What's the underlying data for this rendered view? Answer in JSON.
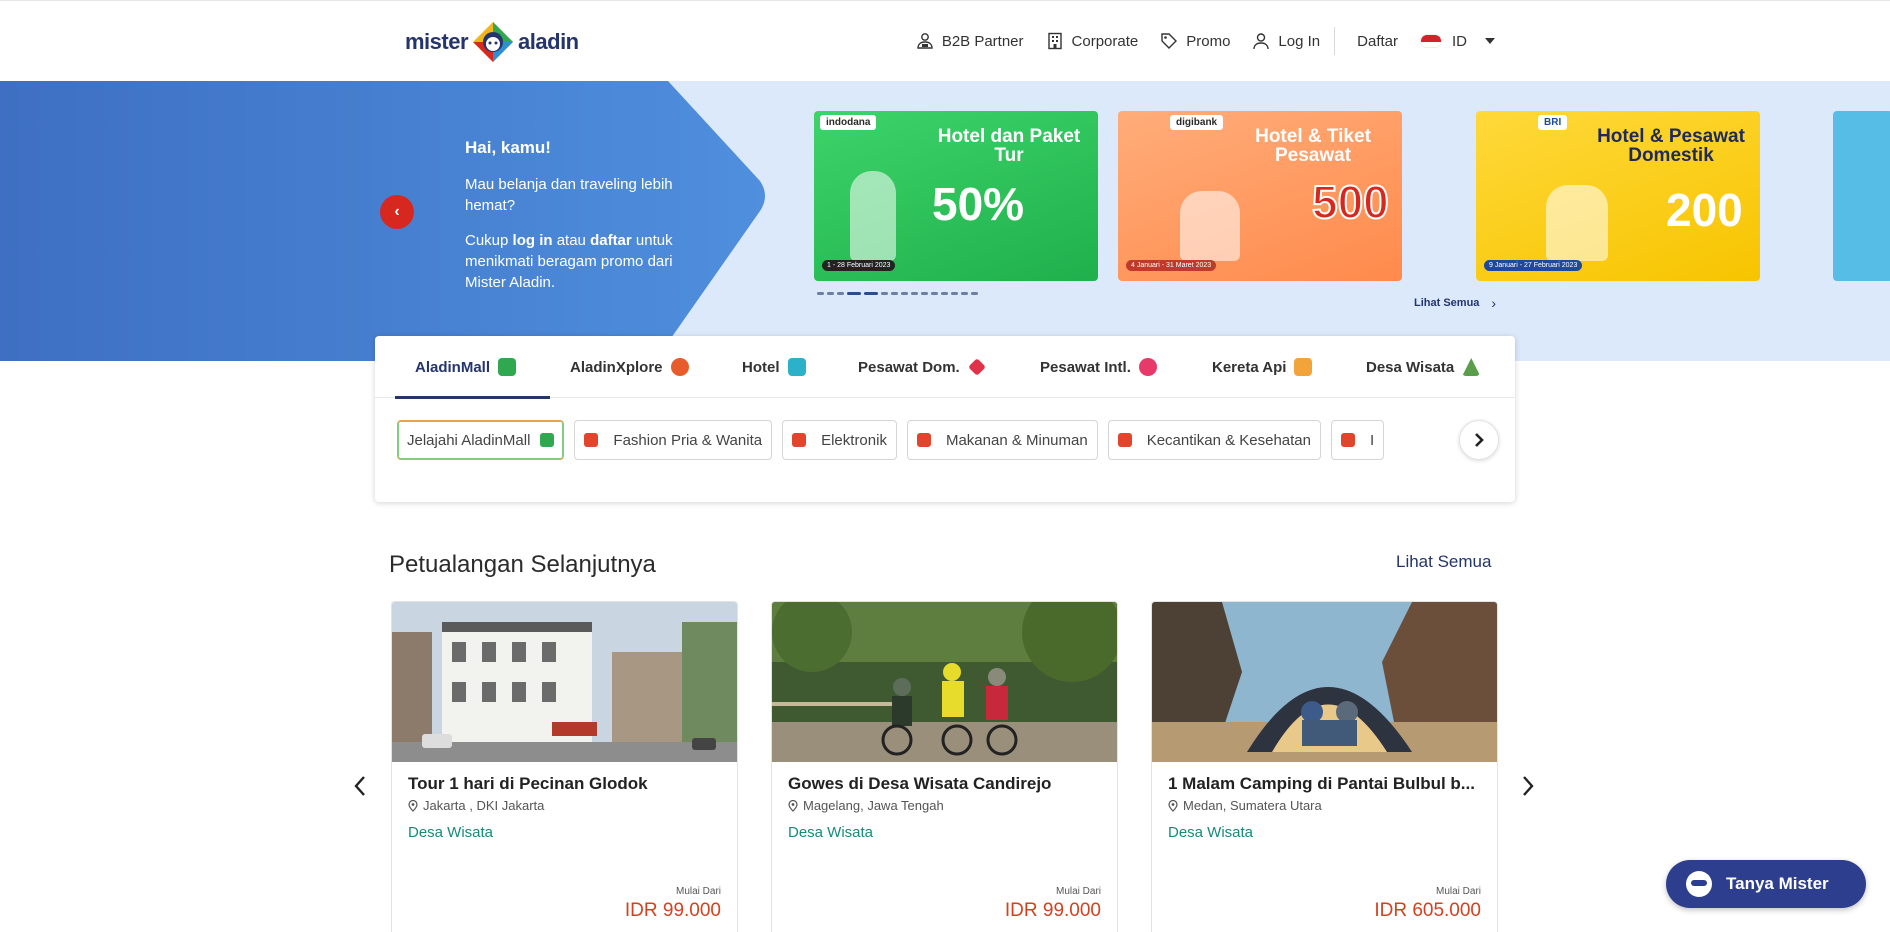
{
  "header": {
    "logo_left": "mister",
    "logo_right": "aladin",
    "nav": [
      {
        "label": "B2B Partner",
        "icon": "b2b-partner-icon"
      },
      {
        "label": "Corporate",
        "icon": "building-icon"
      },
      {
        "label": "Promo",
        "icon": "tag-icon"
      },
      {
        "label": "Log In",
        "icon": "user-icon"
      }
    ],
    "register": "Daftar",
    "lang": "ID"
  },
  "hero": {
    "greeting": "Hai, kamu!",
    "line1": "Mau belanja dan traveling lebih hemat?",
    "line2_a": "Cukup ",
    "line2_login": "log in",
    "line2_b": " atau ",
    "line2_register": "daftar",
    "line2_c": " untuk menikmati beragam promo dari Mister Aladin.",
    "see_all": "Lihat Semua",
    "banners": [
      {
        "brand": "indodana",
        "title": "Hotel dan Paket Tur",
        "big": "50%",
        "dates": "1 - 28 Februari 2023",
        "color": "#2cc35a"
      },
      {
        "brand": "digibank",
        "title": "Hotel & Tiket Pesawat",
        "big": "500",
        "dates": "4 Januari - 31 Maret 2023",
        "color": "#ff9a62"
      },
      {
        "brand": "BRI",
        "title": "Hotel & Pesawat Domestik",
        "big": "200",
        "dates": "9 Januari - 27 Februari 2023",
        "color": "#f9cc12"
      }
    ]
  },
  "tabs": [
    {
      "label": "AladinMall",
      "color": "#2fa84f",
      "active": true
    },
    {
      "label": "AladinXplore",
      "color": "#e85c2b"
    },
    {
      "label": "Hotel",
      "color": "#2bb2c9"
    },
    {
      "label": "Pesawat Dom.",
      "color": "#e0334a"
    },
    {
      "label": "Pesawat Intl.",
      "color": "#e8396b"
    },
    {
      "label": "Kereta Api",
      "color": "#f2a33a"
    },
    {
      "label": "Desa Wisata",
      "color": "#5a9e4b"
    }
  ],
  "chips": [
    {
      "label": "Jelajahi AladinMall",
      "color": "#2fa84f"
    },
    {
      "label": "Fashion Pria & Wanita",
      "color": "#e2452c"
    },
    {
      "label": "Elektronik",
      "color": "#e2452c"
    },
    {
      "label": "Makanan & Minuman",
      "color": "#e2452c"
    },
    {
      "label": "Kecantikan & Kesehatan",
      "color": "#e2452c"
    },
    {
      "label": "I",
      "color": "#e2452c"
    }
  ],
  "section": {
    "title": "Petualangan Selanjutnya",
    "see_all": "Lihat Semua"
  },
  "cards": [
    {
      "title": "Tour 1 hari di Pecinan Glodok",
      "location": "Jakarta , DKI Jakarta",
      "category": "Desa Wisata",
      "from": "Mulai Dari",
      "price": "IDR 99.000"
    },
    {
      "title": "Gowes di Desa Wisata Candirejo",
      "location": "Magelang, Jawa Tengah",
      "category": "Desa Wisata",
      "from": "Mulai Dari",
      "price": "IDR 99.000"
    },
    {
      "title": "1 Malam Camping di Pantai Bulbul b...",
      "location": "Medan, Sumatera Utara",
      "category": "Desa Wisata",
      "from": "Mulai Dari",
      "price": "IDR 605.000"
    }
  ],
  "chat_button": "Tanya Mister",
  "colors": {
    "brand_navy": "#24346d",
    "accent_red": "#d7401f",
    "hero_blue": "#4a86d6",
    "teal": "#188a78"
  }
}
